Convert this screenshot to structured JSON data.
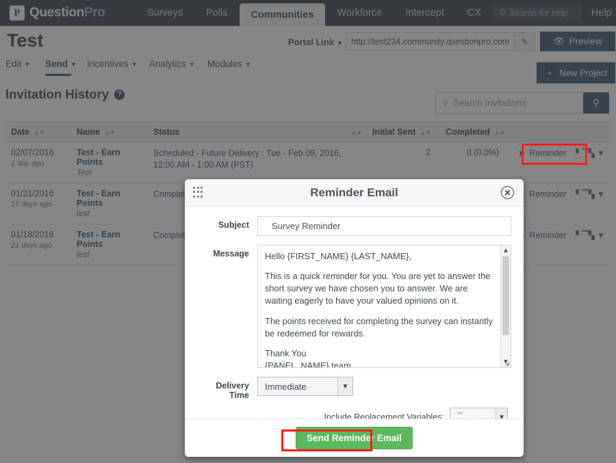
{
  "topnav": {
    "brand": {
      "mark": "P",
      "name_dark": "Question",
      "name_light": "Pro"
    },
    "items": [
      {
        "label": "Surveys",
        "active": false
      },
      {
        "label": "Polls",
        "active": false
      },
      {
        "label": "Communities",
        "active": true
      },
      {
        "label": "Workforce",
        "active": false
      },
      {
        "label": "Intercept",
        "active": false
      },
      {
        "label": "CX",
        "active": false
      }
    ],
    "search_placeholder": "Search for help",
    "help_label": "Help",
    "icons": {
      "search": "search-icon",
      "bell": "bell-icon",
      "avatar": "user-avatar-icon",
      "caret": "chevron-down-icon"
    }
  },
  "project": {
    "title": "Test",
    "portal_link_label": "Portal Link",
    "url_value": "http://test234.community.questionpro.com",
    "edit_icon": "pencil-icon",
    "preview_label": "Preview",
    "preview_icon": "eye-icon",
    "new_project_label": "New Project",
    "new_project_icon": "plus-icon"
  },
  "submenu": {
    "items": [
      {
        "label": "Edit",
        "active": false
      },
      {
        "label": "Send",
        "active": true
      },
      {
        "label": "Incentives",
        "active": false
      },
      {
        "label": "Analytics",
        "active": false
      },
      {
        "label": "Modules",
        "active": false
      }
    ]
  },
  "invitation_history": {
    "title": "Invitation History",
    "help_glyph": "?",
    "search_placeholder": "Search Invitations",
    "search_icon": "search-icon",
    "columns": [
      "Date",
      "Name",
      "Status",
      "Initial Sent",
      "Completed",
      ""
    ],
    "rows": [
      {
        "date": "02/07/2016",
        "date_ago": "1 day ago",
        "name": "Test - Earn Points",
        "name_sub": "Test",
        "status": "Scheduled - Future Delivery : Tue - Feb 09, 2016, 12:00 AM - 1:00 AM (PST)",
        "initial_sent": "2",
        "completed": "0 (0.0%)",
        "action": "Reminder",
        "action_icon": "share-arrow-icon",
        "chart_icon": "bar-chart-icon"
      },
      {
        "date": "01/21/2016",
        "date_ago": "17 days ago",
        "name": "Test - Earn Points",
        "name_sub": "test",
        "status": "Complete",
        "initial_sent": "",
        "completed": "",
        "action": "Reminder",
        "action_icon": "share-arrow-icon",
        "chart_icon": "bar-chart-icon"
      },
      {
        "date": "01/18/2016",
        "date_ago": "21 days ago",
        "name": "Test - Earn Points",
        "name_sub": "test",
        "status": "Complete",
        "initial_sent": "",
        "completed": "",
        "action": "Reminder",
        "action_icon": "share-arrow-icon",
        "chart_icon": "bar-chart-icon"
      }
    ]
  },
  "modal": {
    "title": "Reminder Email",
    "close_icon": "close-circle-icon",
    "drag_handle_icon": "drag-grip-icon",
    "subject_label": "Subject",
    "subject_value": "Survey Reminder",
    "message_label": "Message",
    "message_paragraphs": [
      "Hello {FIRST_NAME} {LAST_NAME},",
      "This is a quick reminder for you. You are yet to answer the short survey we have chosen you to answer. We are waiting eagerly to have your valued opinions on it.",
      "The points received for completing the survey can instantly be redeemed for rewards.",
      "Thank You",
      "{PANEL_NAME} team"
    ],
    "delivery_label": "Delivery Time",
    "delivery_value": "Immediate",
    "replacement_label": "Include Replacement Variables:",
    "replacement_value": "-- Select -",
    "send_label": "Send Reminder Email"
  },
  "annotations": {
    "highlight_color": "#ff1b1b",
    "boxes": [
      "reminder-link-highlight",
      "send-reminder-email-highlight"
    ]
  }
}
